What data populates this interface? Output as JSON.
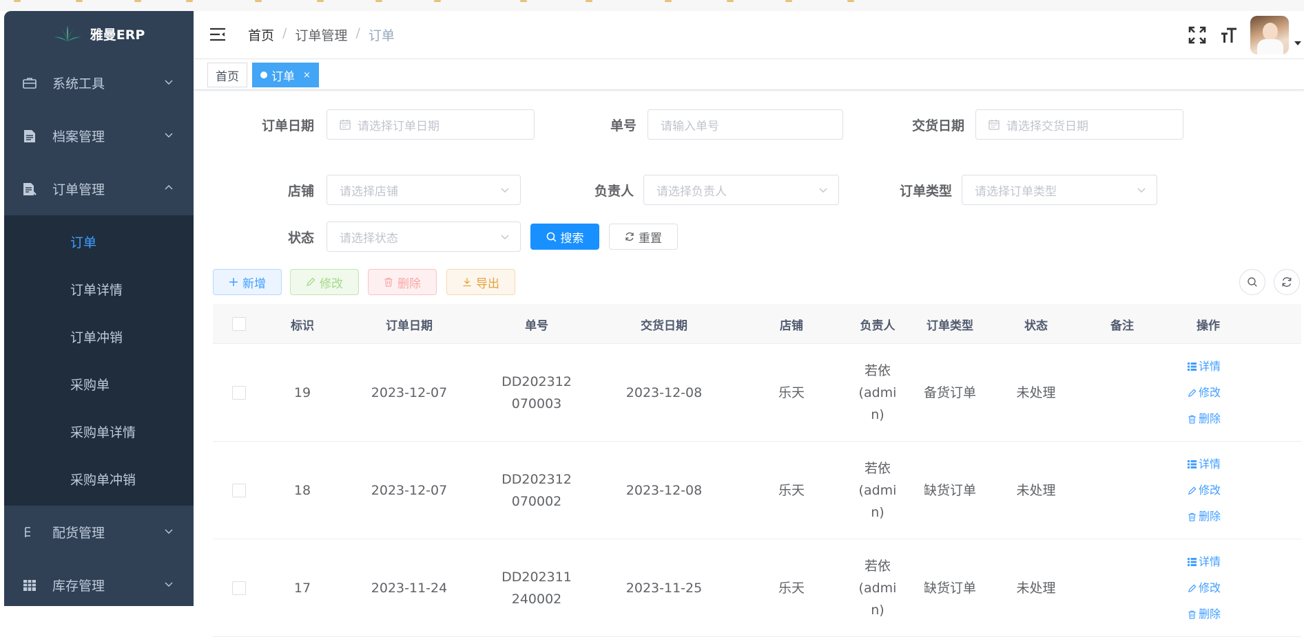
{
  "app": {
    "name": "雅曼ERP"
  },
  "sidebar": {
    "items": [
      {
        "label": "系统工具",
        "icon": "toolbox-icon"
      },
      {
        "label": "档案管理",
        "icon": "document-icon"
      },
      {
        "label": "订单管理",
        "icon": "order-doc-icon",
        "expanded": true,
        "children": [
          "订单",
          "订单详情",
          "订单冲销",
          "采购单",
          "采购单详情",
          "采购单冲销"
        ],
        "active_child": "订单"
      },
      {
        "label": "配货管理",
        "icon": "tree-icon"
      },
      {
        "label": "库存管理",
        "icon": "grid-icon"
      }
    ]
  },
  "header": {
    "breadcrumb": [
      "首页",
      "订单管理",
      "订单"
    ],
    "separator": "/"
  },
  "tags": [
    {
      "label": "首页",
      "active": false
    },
    {
      "label": "订单",
      "active": true,
      "close": "×"
    }
  ],
  "form": {
    "order_date": {
      "label": "订单日期",
      "placeholder": "请选择订单日期"
    },
    "order_no": {
      "label": "单号",
      "placeholder": "请输入单号"
    },
    "delivery_date": {
      "label": "交货日期",
      "placeholder": "请选择交货日期"
    },
    "shop": {
      "label": "店铺",
      "placeholder": "请选择店铺"
    },
    "owner": {
      "label": "负责人",
      "placeholder": "请选择负责人"
    },
    "order_type": {
      "label": "订单类型",
      "placeholder": "请选择订单类型"
    },
    "status": {
      "label": "状态",
      "placeholder": "请选择状态"
    },
    "search_button": "搜索",
    "reset_button": "重置"
  },
  "toolbar": {
    "add": "新增",
    "edit": "修改",
    "delete": "删除",
    "export": "导出"
  },
  "table": {
    "columns": [
      "标识",
      "订单日期",
      "单号",
      "交货日期",
      "店铺",
      "负责人",
      "订单类型",
      "状态",
      "备注",
      "操作"
    ],
    "ops": [
      "详情",
      "修改",
      "删除"
    ],
    "rows": [
      {
        "id": "19",
        "order_date": "2023-12-07",
        "order_no_1": "DD202312",
        "order_no_2": "070003",
        "delivery_date": "2023-12-08",
        "shop": "乐天",
        "owner_1": "若依(admi",
        "owner_2": "n)",
        "type": "备货订单",
        "status": "未处理",
        "note": ""
      },
      {
        "id": "18",
        "order_date": "2023-12-07",
        "order_no_1": "DD202312",
        "order_no_2": "070002",
        "delivery_date": "2023-12-08",
        "shop": "乐天",
        "owner_1": "若依(admi",
        "owner_2": "n)",
        "type": "缺货订单",
        "status": "未处理",
        "note": ""
      },
      {
        "id": "17",
        "order_date": "2023-11-24",
        "order_no_1": "DD202311",
        "order_no_2": "240002",
        "delivery_date": "2023-11-25",
        "shop": "乐天",
        "owner_1": "若依(admi",
        "owner_2": "n)",
        "type": "缺货订单",
        "status": "未处理",
        "note": ""
      }
    ]
  },
  "colors": {
    "sidebar_bg": "#304156",
    "submenu_bg": "#1f2d3d",
    "accent": "#409eff",
    "primary_button": "#1890ff"
  }
}
